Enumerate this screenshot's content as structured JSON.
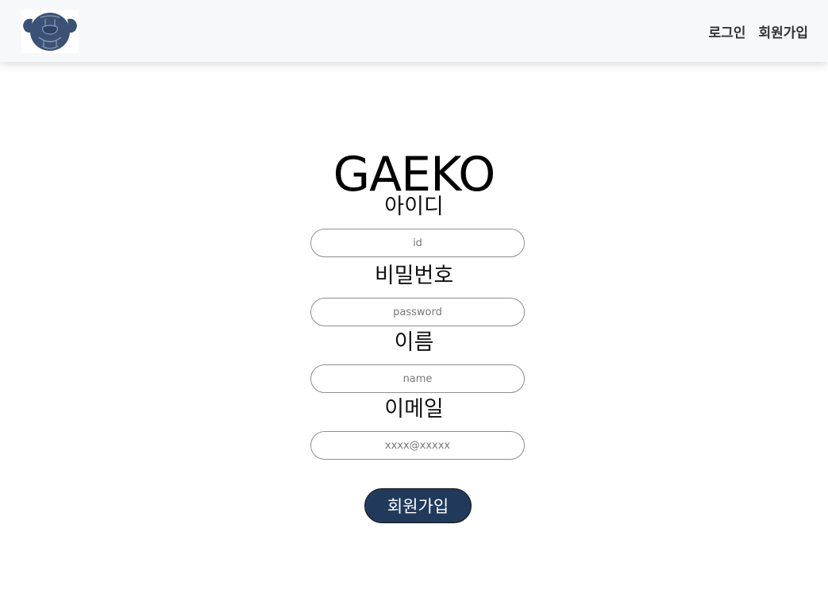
{
  "header": {
    "logo_icon": "bulldog-logo-icon",
    "nav": {
      "login_label": "로그인",
      "signup_label": "회원가입"
    }
  },
  "form": {
    "title": "GAEKO",
    "id_label": "아이디",
    "id_placeholder": "id",
    "password_label": "비밀번호",
    "password_placeholder": "password",
    "name_label": "이름",
    "name_placeholder": "name",
    "email_label": "이메일",
    "email_placeholder": "xxxx@xxxxx",
    "submit_label": "회원가입"
  },
  "colors": {
    "accent": "#213a5c",
    "navbar_bg": "#f7f8fa"
  }
}
